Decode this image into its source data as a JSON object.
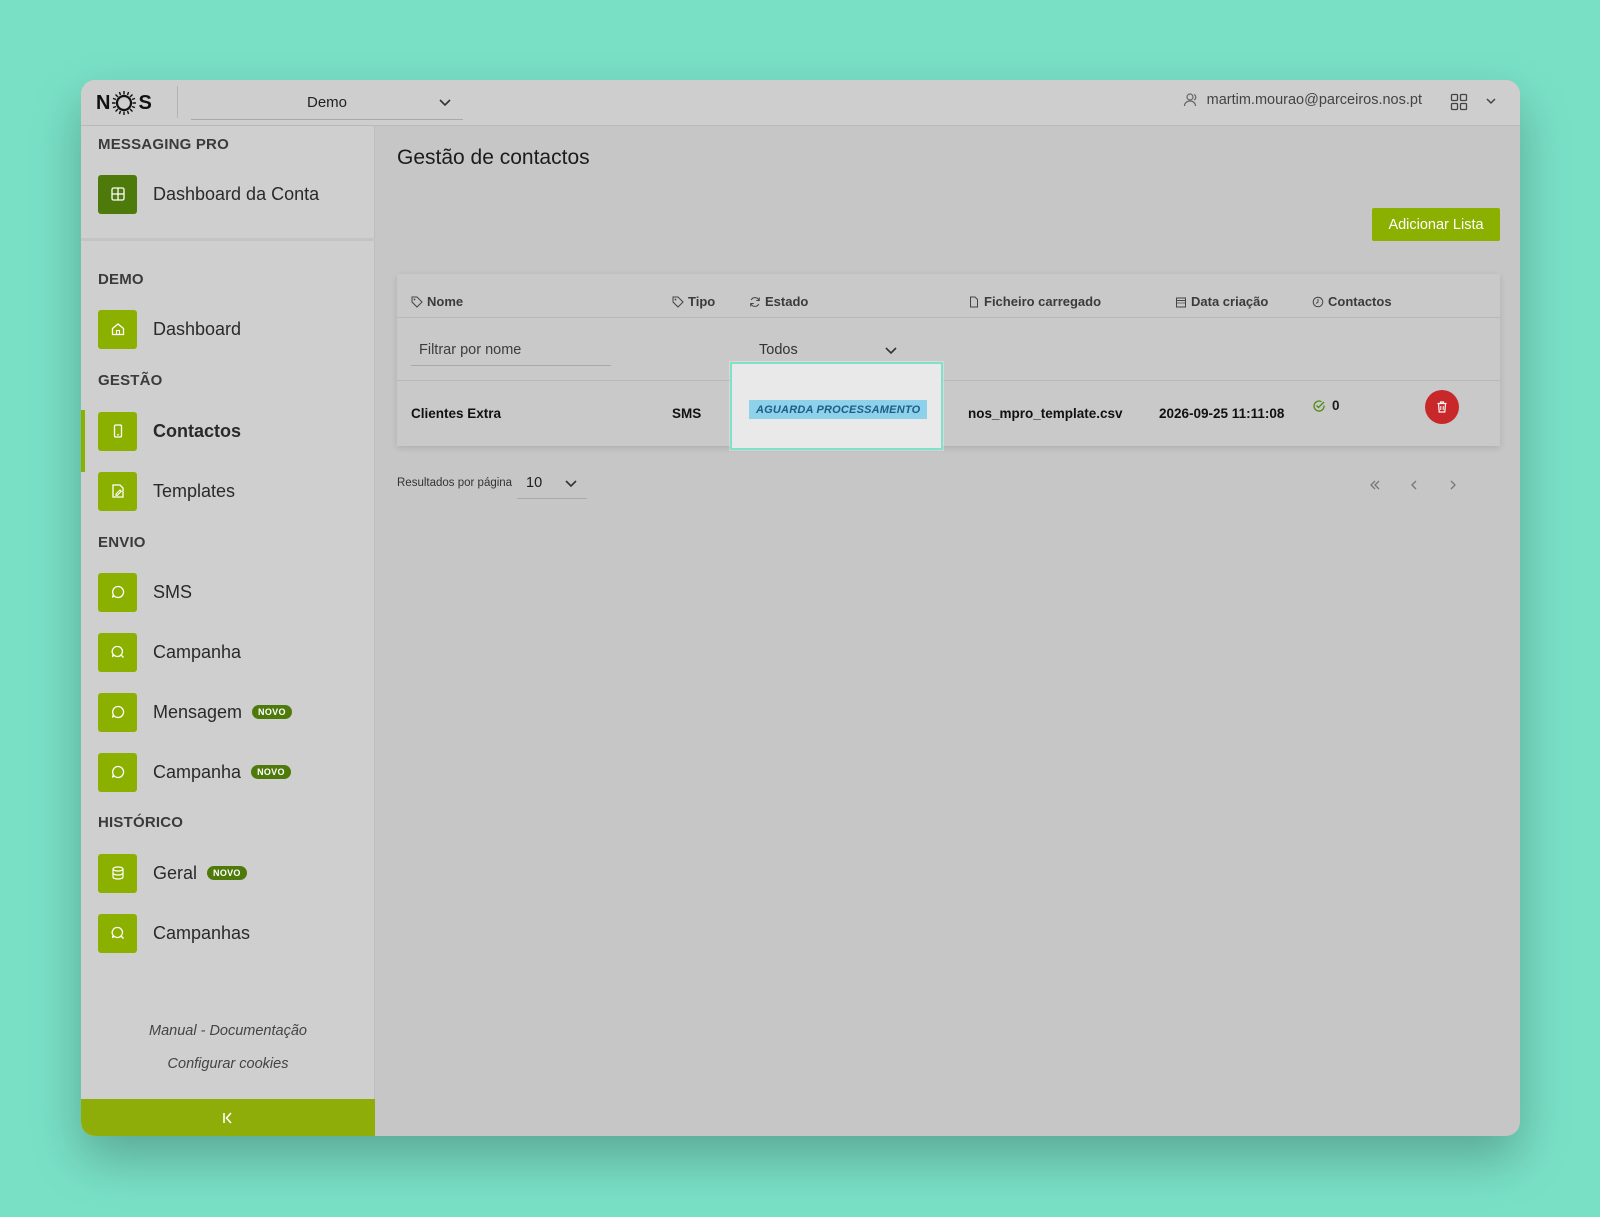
{
  "brand": {
    "logo_text_left": "N",
    "logo_text_right": "S"
  },
  "topbar": {
    "workspace": "Demo",
    "user_email": "martim.mourao@parceiros.nos.pt"
  },
  "sidebar": {
    "sections": {
      "messaging_pro": "MESSAGING PRO",
      "demo": "DEMO",
      "gestao": "GESTÃO",
      "envio": "ENVIO",
      "historico": "HISTÓRICO"
    },
    "items": {
      "dashboard_conta": "Dashboard da Conta",
      "dashboard": "Dashboard",
      "contactos": "Contactos",
      "templates": "Templates",
      "sms": "SMS",
      "campanha": "Campanha",
      "mensagem": "Mensagem",
      "campanha_novo": "Campanha",
      "geral": "Geral",
      "campanhas": "Campanhas"
    },
    "badge_new": "NOVO",
    "footer": {
      "manual": "Manual - Documentação",
      "cookies": "Configurar cookies"
    }
  },
  "main": {
    "title": "Gestão de contactos",
    "add_button": "Adicionar Lista",
    "columns": {
      "name": "Nome",
      "type": "Tipo",
      "state": "Estado",
      "file": "Ficheiro carregado",
      "created": "Data criação",
      "contacts": "Contactos"
    },
    "filter": {
      "name_placeholder": "Filtrar por nome",
      "state_value": "Todos"
    },
    "rows": [
      {
        "name": "Clientes Extra",
        "type": "SMS",
        "state": "AGUARDA PROCESSAMENTO",
        "file": "nos_mpro_template.csv",
        "created": "2026-09-25 11:11:08",
        "contacts": "0"
      }
    ],
    "pagination": {
      "per_page_label": "Resultados por página",
      "per_page_value": "10"
    }
  },
  "colors": {
    "background": "#79e0c6",
    "accent": "#8cb000",
    "accent_dark": "#4d7a0b",
    "delete": "#c8282a",
    "status_badge": "#8ed1eb"
  }
}
